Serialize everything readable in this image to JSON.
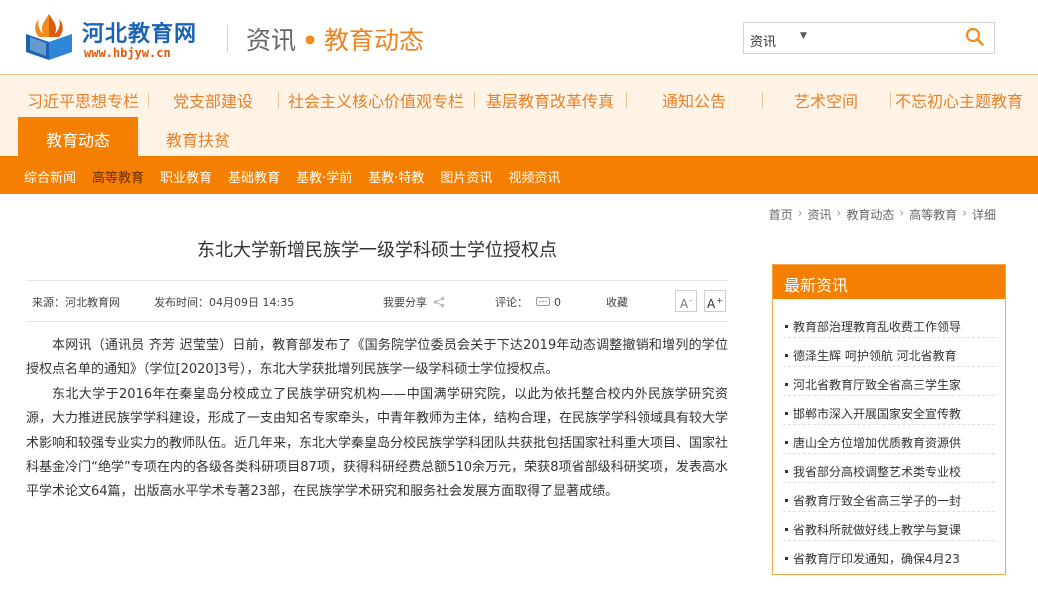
{
  "header": {
    "logo_name": "河北教育网",
    "logo_url": "www.hbjyw.cn",
    "title_main": "资讯",
    "title_dot": "•",
    "title_sub": "教育动态",
    "search": {
      "select_value": "资讯",
      "placeholder": ""
    }
  },
  "nav": {
    "row1": [
      "习近平思想专栏",
      "党支部建设",
      "社会主义核心价值观专栏",
      "基层教育改革传真",
      "通知公告",
      "艺术空间",
      "不忘初心主题教育"
    ],
    "row2": [
      "教育动态",
      "教育扶贫"
    ]
  },
  "subnav": [
    "综合新闻",
    "高等教育",
    "职业教育",
    "基础教育",
    "基教·学前",
    "基教·特教",
    "图片资讯",
    "视频资讯"
  ],
  "breadcrumb": [
    "首页",
    "资讯",
    "教育动态",
    "高等教育",
    "详细"
  ],
  "article": {
    "title": "东北大学新增民族学一级学科硕士学位授权点",
    "source": "来源：河北教育网",
    "date": "发布时间：04月09日 14:35",
    "share": "我要分享",
    "comment_label": "评论：",
    "comment_count": "0",
    "favorite": "收藏",
    "font_small": "A",
    "font_large": "A",
    "paragraphs": [
      "本网讯（通讯员 齐芳 迟莹莹）日前，教育部发布了《国务院学位委员会关于下达2019年动态调整撤销和增列的学位授权点名单的通知》（学位[2020]3号），东北大学获批增列民族学一级学科硕士学位授权点。",
      "东北大学于2016年在秦皇岛分校成立了民族学研究机构——中国满学研究院，以此为依托整合校内外民族学研究资源，大力推进民族学学科建设，形成了一支由知名专家牵头，中青年教师为主体，结构合理，在民族学学科领域具有较大学术影响和较强专业实力的教师队伍。近几年来，东北大学秦皇岛分校民族学学科团队共获批包括国家社科重大项目、国家社科基金冷门“绝学”专项在内的各级各类科研项目87项，获得科研经费总额510余万元，荣获8项省部级科研奖项，发表高水平学术论文64篇，出版高水平学术专著23部，在民族学学术研究和服务社会发展方面取得了显著成绩。"
    ]
  },
  "sidebar": {
    "title": "最新资讯",
    "items": [
      "教育部治理教育乱收费工作领导",
      "德泽生辉 呵护领航 河北省教育",
      "河北省教育厅致全省高三学生家",
      "邯郸市深入开展国家安全宣传教",
      "唐山全方位增加优质教育资源供",
      "我省部分高校调整艺术类专业校",
      "省教育厅致全省高三学子的一封",
      "省教科所就做好线上教学与复课",
      "省教育厅印发通知，确保4月23"
    ]
  },
  "colors": {
    "brand_orange": "#f57f00",
    "nav_text": "#e6812c",
    "logo_blue": "#1a64b4",
    "nav_bg": "#fef3e5"
  }
}
